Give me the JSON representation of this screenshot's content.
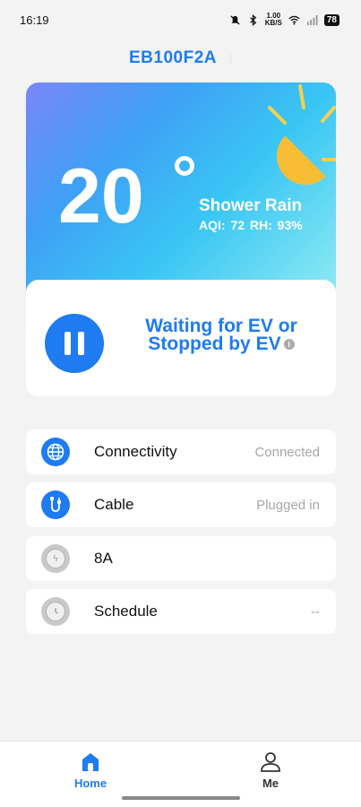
{
  "status_bar": {
    "time": "16:19",
    "speed_top": "1.00",
    "speed_bottom": "KB/S",
    "battery": "78"
  },
  "device": {
    "title": "EB100F2A"
  },
  "weather": {
    "temperature": "20",
    "condition": "Shower Rain",
    "aqi": "AQI: 72",
    "rh": "RH: 93%"
  },
  "charger": {
    "status_line1": "Waiting for EV or",
    "status_line2": "Stopped by EV",
    "info_icon": "i"
  },
  "rows": [
    {
      "label": "Connectivity",
      "value": "Connected",
      "icon": "globe-icon"
    },
    {
      "label": "Cable",
      "value": "Plugged in",
      "icon": "cable-icon"
    },
    {
      "label": "8A",
      "value": "",
      "icon": "current-icon"
    },
    {
      "label": "Schedule",
      "value": "--",
      "icon": "schedule-icon"
    }
  ],
  "nav": {
    "home": "Home",
    "me": "Me"
  },
  "colors": {
    "accent": "#1e7bf2",
    "sun": "#f7bd35"
  }
}
